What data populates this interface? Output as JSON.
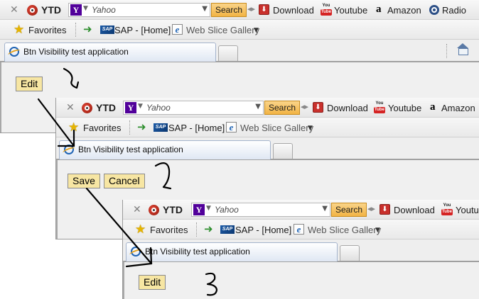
{
  "toolbar": {
    "ytd_label": "YTD",
    "search_engine": "Yahoo",
    "search_button": "Search",
    "links": [
      "Download",
      "Youtube",
      "Amazon",
      "Radio"
    ],
    "yt_icon_top": "You",
    "yt_icon_bottom": "Tube",
    "amazon_icon": "a",
    "yahoo_icon": "Y"
  },
  "favorites_bar": {
    "favorites_label": "Favorites",
    "sap_icon": "SAP",
    "sap_link": "SAP - [Home]",
    "web_slice_label": "Web Slice Gallery"
  },
  "tab": {
    "title": "Btn Visibility test application"
  },
  "screens": [
    {
      "buttons": [
        "Edit"
      ]
    },
    {
      "buttons": [
        "Save",
        "Cancel"
      ]
    },
    {
      "buttons": [
        "Edit"
      ]
    }
  ],
  "annotations": {
    "step_marks": [
      "1",
      "2",
      "3"
    ]
  },
  "colors": {
    "search_button": "#f2b445",
    "app_button": "#f7e6a3",
    "yahoo_purple": "#51009a",
    "annotation_ink": "#000000"
  }
}
